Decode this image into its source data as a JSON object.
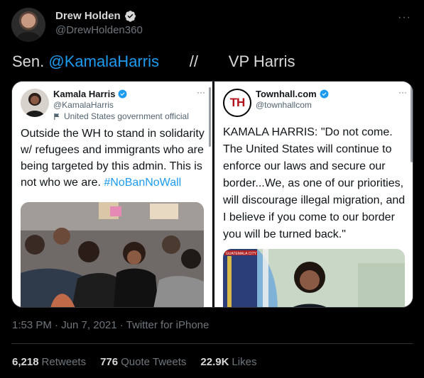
{
  "author": {
    "name": "Drew Holden",
    "handle": "@DrewHolden360",
    "more": "···"
  },
  "tweet": {
    "prefix": "Sen. ",
    "mention": "@KamalaHarris",
    "rest": "       //       VP Harris"
  },
  "left_embed": {
    "name": "Kamala Harris",
    "handle": "@KamalaHarris",
    "official_label": "United States government official",
    "more": "···",
    "text": "Outside the WH to stand in solidarity w/ refugees and immigrants who are being targeted by this admin. This is not who we are. ",
    "hashtag": "#NoBanNoWall"
  },
  "right_embed": {
    "name": "Townhall.com",
    "handle": "@townhallcom",
    "avatar_letters": "TH",
    "more": "···",
    "text": "KAMALA HARRIS: \"Do not come. The United States will continue to enforce our laws and secure our border...We, as one of our priorities, will discourage illegal migration, and I believe if you come to our border you will be turned back.\"",
    "photo_caption": "GUATEMALA CITY"
  },
  "meta": "1:53 PM · Jun 7, 2021 · Twitter for iPhone",
  "stats": {
    "retweets_count": "6,218",
    "retweets_label": "Retweets",
    "quotes_count": "776",
    "quotes_label": "Quote Tweets",
    "likes_count": "22.9K",
    "likes_label": "Likes"
  },
  "colors": {
    "background": "#000000",
    "link": "#1d9bf0",
    "secondary": "#6e767d",
    "verified": "#1d9bf0"
  }
}
